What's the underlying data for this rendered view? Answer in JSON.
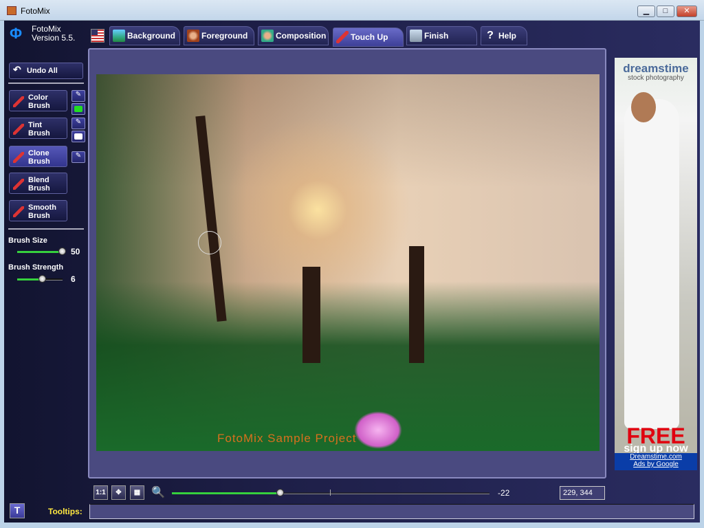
{
  "window": {
    "title": "FotoMix",
    "minimize": "▁",
    "maximize": "□",
    "close": "✕"
  },
  "app": {
    "name": "FotoMix",
    "version": "Version 5.5."
  },
  "tabs": [
    {
      "label": "Background",
      "icon": "landscape-icon",
      "active": false
    },
    {
      "label": "Foreground",
      "icon": "portrait-icon",
      "active": false
    },
    {
      "label": "Composition",
      "icon": "composition-icon",
      "active": false
    },
    {
      "label": "Touch Up",
      "icon": "brush-icon",
      "active": true
    },
    {
      "label": "Finish",
      "icon": "finish-icon",
      "active": false
    },
    {
      "label": "Help",
      "icon": "question-icon",
      "active": false
    }
  ],
  "sidebar": {
    "undo_all": "Undo All",
    "brushes": [
      {
        "line1": "Color",
        "line2": "Brush",
        "active": false
      },
      {
        "line1": "Tint",
        "line2": "Brush",
        "active": false
      },
      {
        "line1": "Clone",
        "line2": "Brush",
        "active": true
      },
      {
        "line1": "Blend",
        "line2": "Brush",
        "active": false
      },
      {
        "line1": "Smooth",
        "line2": "Brush",
        "active": false
      }
    ],
    "color_swatch": "#22dd22",
    "tint_swatch": "#ffffff",
    "brush_size_label": "Brush Size",
    "brush_size": "50",
    "brush_strength_label": "Brush Strength",
    "brush_strength": "6"
  },
  "canvas": {
    "watermark": "FotoMix Sample Project"
  },
  "ad": {
    "brand": "dreamstime",
    "tagline": "stock photography",
    "headline": "FREE",
    "sub": "sign up now",
    "link": "Dreamstime.com",
    "by": "Ads by Google"
  },
  "bottom": {
    "btn_1to1": "1:1",
    "zoom_value": "-22",
    "zoom_fraction": 0.34,
    "coords": "229, 344",
    "tooltips_label": "Tooltips:",
    "tooltip_text": ""
  }
}
